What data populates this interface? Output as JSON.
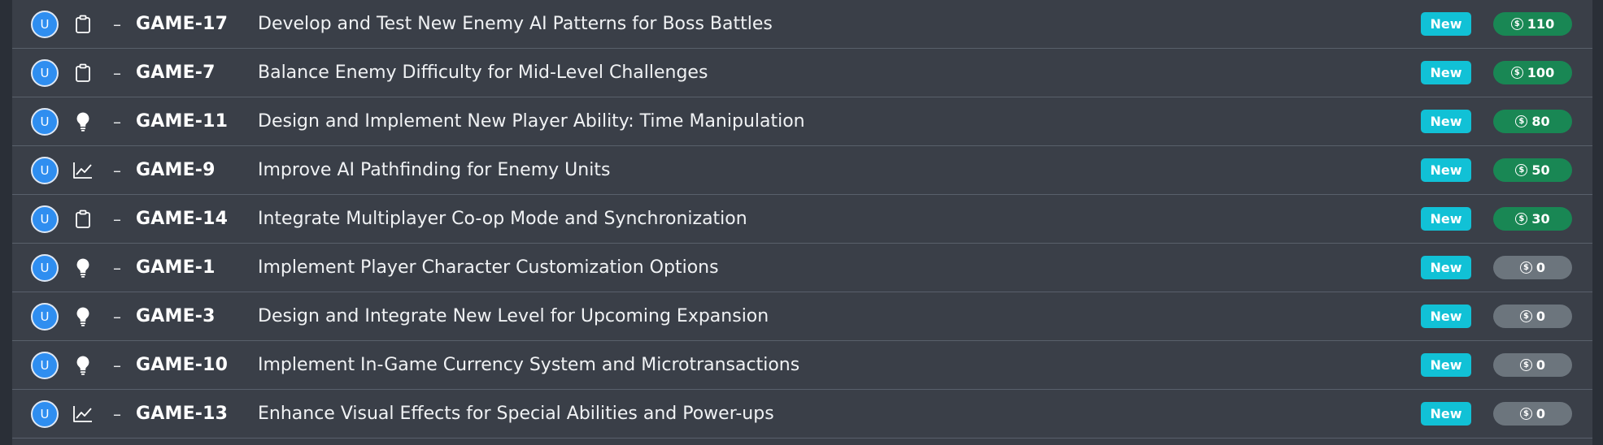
{
  "avatar_letter": "U",
  "dash": "–",
  "coin_symbol": "$",
  "colors": {
    "points_active": "#198754",
    "points_zero": "#6c757d",
    "status_new": "#11c1d6",
    "avatar": "#2f8ef0"
  },
  "issues": [
    {
      "type_icon": "clipboard-icon",
      "key": "GAME-17",
      "title": "Develop and Test New Enemy AI Patterns for Boss Battles",
      "status": "New",
      "points": "110",
      "points_state": "active"
    },
    {
      "type_icon": "clipboard-icon",
      "key": "GAME-7",
      "title": "Balance Enemy Difficulty for Mid-Level Challenges",
      "status": "New",
      "points": "100",
      "points_state": "active"
    },
    {
      "type_icon": "lightbulb-icon",
      "key": "GAME-11",
      "title": "Design and Implement New Player Ability: Time Manipulation",
      "status": "New",
      "points": "80",
      "points_state": "active"
    },
    {
      "type_icon": "chart-line-icon",
      "key": "GAME-9",
      "title": "Improve AI Pathfinding for Enemy Units",
      "status": "New",
      "points": "50",
      "points_state": "active"
    },
    {
      "type_icon": "clipboard-icon",
      "key": "GAME-14",
      "title": "Integrate Multiplayer Co-op Mode and Synchronization",
      "status": "New",
      "points": "30",
      "points_state": "active"
    },
    {
      "type_icon": "lightbulb-icon",
      "key": "GAME-1",
      "title": "Implement Player Character Customization Options",
      "status": "New",
      "points": "0",
      "points_state": "zero"
    },
    {
      "type_icon": "lightbulb-icon",
      "key": "GAME-3",
      "title": "Design and Integrate New Level for Upcoming Expansion",
      "status": "New",
      "points": "0",
      "points_state": "zero"
    },
    {
      "type_icon": "lightbulb-icon",
      "key": "GAME-10",
      "title": "Implement In-Game Currency System and Microtransactions",
      "status": "New",
      "points": "0",
      "points_state": "zero"
    },
    {
      "type_icon": "chart-line-icon",
      "key": "GAME-13",
      "title": "Enhance Visual Effects for Special Abilities and Power-ups",
      "status": "New",
      "points": "0",
      "points_state": "zero"
    }
  ]
}
